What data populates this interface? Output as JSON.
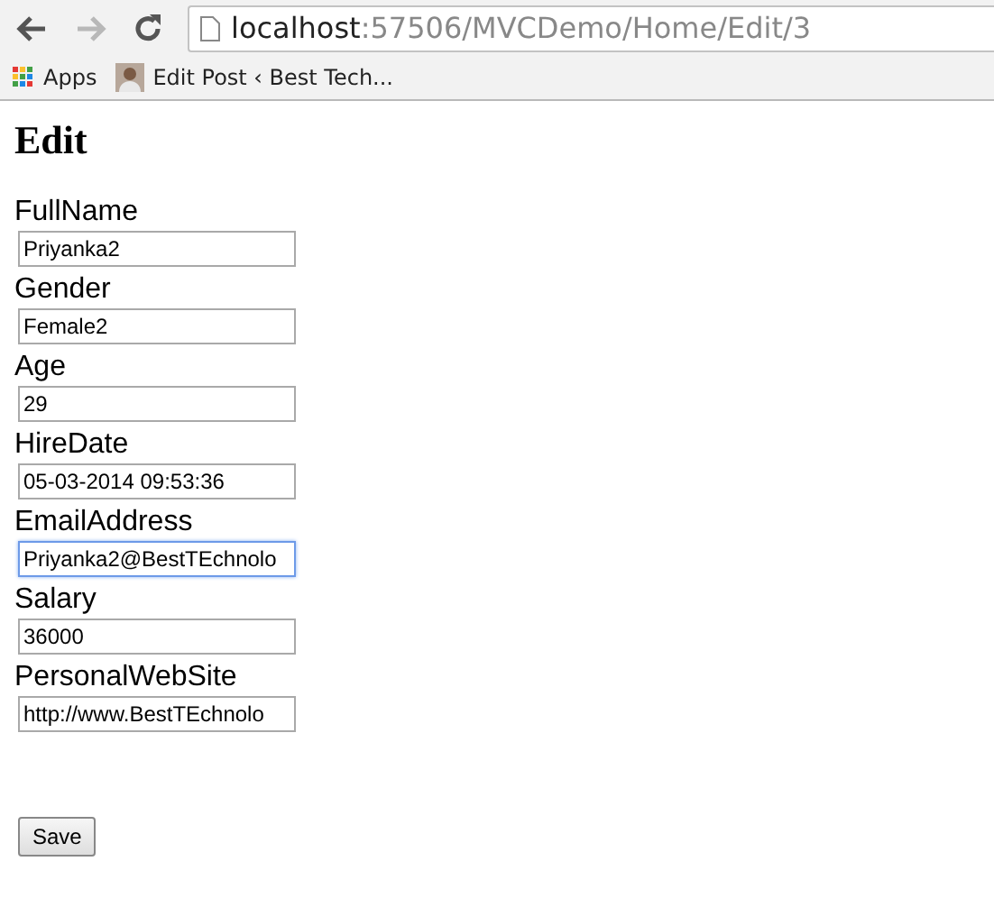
{
  "browser": {
    "nav_buttons": [
      {
        "kind": "back",
        "disabled": false
      },
      {
        "kind": "forward",
        "disabled": true
      },
      {
        "kind": "reload",
        "disabled": false
      }
    ],
    "address": {
      "host": "localhost",
      "rest": ":57506/MVCDemo/Home/Edit/3"
    },
    "bookmarks": [
      {
        "kind": "apps",
        "label": "Apps"
      },
      {
        "kind": "page",
        "label": "Edit Post ‹ Best Tech..."
      }
    ]
  },
  "page": {
    "heading": "Edit",
    "fields": [
      {
        "label": "FullName",
        "value": "Priyanka2",
        "focused": false
      },
      {
        "label": "Gender",
        "value": "Female2",
        "focused": false
      },
      {
        "label": "Age",
        "value": "29",
        "focused": false
      },
      {
        "label": "HireDate",
        "value": "05-03-2014 09:53:36",
        "focused": false
      },
      {
        "label": "EmailAddress",
        "value": "Priyanka2@BestTEchnolo",
        "focused": true
      },
      {
        "label": "Salary",
        "value": "36000",
        "focused": false
      },
      {
        "label": "PersonalWebSite",
        "value": "http://www.BestTEchnolo",
        "focused": false
      }
    ],
    "submit": "Save"
  }
}
